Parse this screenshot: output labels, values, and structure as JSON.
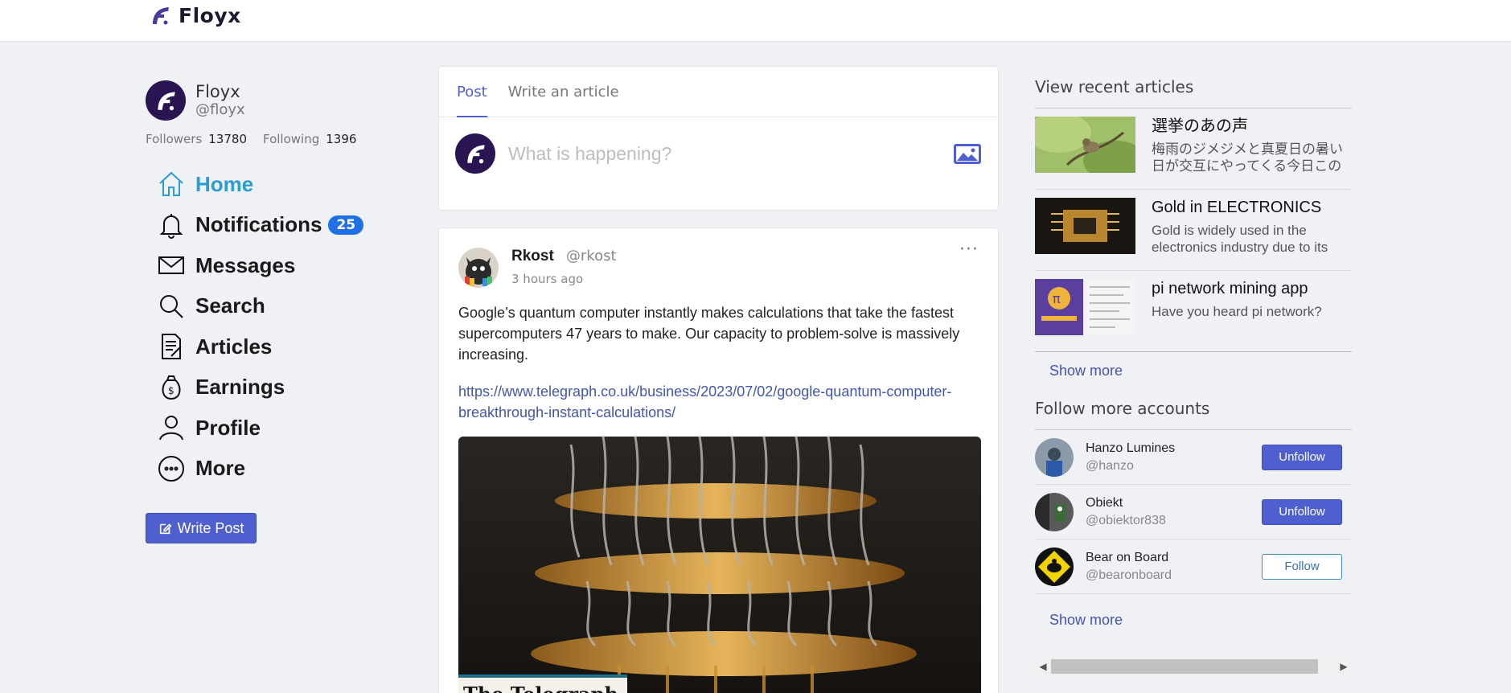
{
  "brand": {
    "name": "Floyx"
  },
  "profile": {
    "name": "Floyx",
    "handle": "@floyx",
    "followers_label": "Followers",
    "followers": "13780",
    "following_label": "Following",
    "following": "1396"
  },
  "nav": {
    "home": "Home",
    "notifications": "Notifications",
    "notifications_badge": "25",
    "messages": "Messages",
    "search": "Search",
    "articles": "Articles",
    "earnings": "Earnings",
    "profile": "Profile",
    "more": "More"
  },
  "write_post_label": "Write Post",
  "composer": {
    "tab_post": "Post",
    "tab_article": "Write an article",
    "placeholder": "What is happening?"
  },
  "post": {
    "author": "Rkost",
    "handle": "@rkost",
    "time": "3 hours ago",
    "text": "Google’s quantum computer instantly makes calculations that take the fastest supercomputers 47 years to make. Our capacity to problem-solve is massively increasing.",
    "link": "https://www.telegraph.co.uk/business/2023/07/02/google-quantum-computer-breakthrough-instant-calculations/",
    "image_caption": "The Telegraph",
    "menu": "···"
  },
  "recent_articles": {
    "title": "View recent articles",
    "items": [
      {
        "title": "選挙のあの声",
        "desc": "梅雨のジメジメと真夏日の暑い日が交互にやってくる今日この頃"
      },
      {
        "title": "Gold in ELECTRONICS",
        "desc": "Gold is widely used in the electronics industry due to its unique properties"
      },
      {
        "title": "pi network mining app",
        "desc": "Have you heard pi network?"
      }
    ],
    "show_more": "Show more"
  },
  "follow_accounts": {
    "title": "Follow more accounts",
    "items": [
      {
        "name": "Hanzo Lumines",
        "handle": "@hanzo",
        "action": "Unfollow"
      },
      {
        "name": "Obiekt",
        "handle": "@obiektor838",
        "action": "Unfollow"
      },
      {
        "name": "Bear on Board",
        "handle": "@bearonboard",
        "action": "Follow"
      }
    ],
    "show_more": "Show more"
  },
  "colors": {
    "accent": "#4f5fd0",
    "home_active": "#2a9cd6",
    "badge": "#1f6fe5",
    "logo_bg": "#2a1552"
  }
}
